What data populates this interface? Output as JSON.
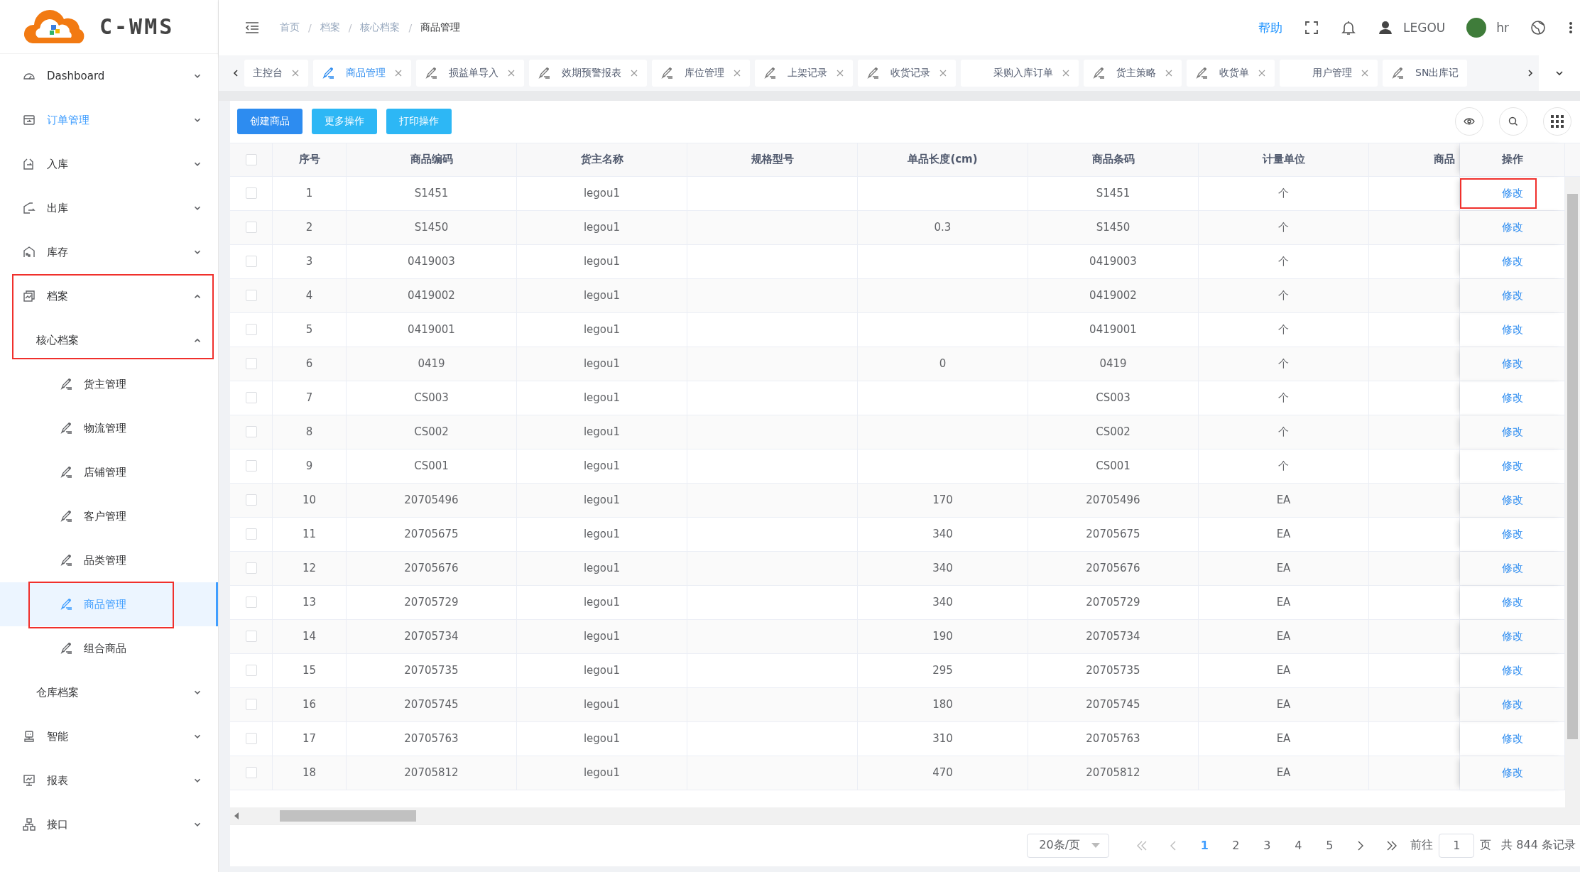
{
  "logo": {
    "text": "C-WMS"
  },
  "sidebar": {
    "menu": [
      {
        "label": "Dashboard",
        "expanded": false,
        "active": false
      },
      {
        "label": "订单管理",
        "expanded": false,
        "active": true
      },
      {
        "label": "入库",
        "expanded": false,
        "active": false
      },
      {
        "label": "出库",
        "expanded": false,
        "active": false
      },
      {
        "label": "库存",
        "expanded": false,
        "active": false
      },
      {
        "label": "档案",
        "expanded": true,
        "active": false,
        "marked": true,
        "children": [
          {
            "label": "核心档案",
            "expanded": true,
            "active": false,
            "marked": true,
            "children": [
              {
                "label": "货主管理",
                "selected": false
              },
              {
                "label": "物流管理",
                "selected": false
              },
              {
                "label": "店铺管理",
                "selected": false
              },
              {
                "label": "客户管理",
                "selected": false
              },
              {
                "label": "品类管理",
                "selected": false
              },
              {
                "label": "商品管理",
                "selected": true,
                "marked": true
              },
              {
                "label": "组合商品",
                "selected": false
              }
            ]
          },
          {
            "label": "仓库档案",
            "expanded": false,
            "active": false
          }
        ]
      },
      {
        "label": "智能",
        "expanded": false,
        "active": false
      },
      {
        "label": "报表",
        "expanded": false,
        "active": false
      },
      {
        "label": "接口",
        "expanded": false,
        "active": false
      }
    ]
  },
  "header": {
    "breadcrumb": [
      "首页",
      "档案",
      "核心档案",
      "商品管理"
    ],
    "separator": "/",
    "help": "帮助",
    "user": "LEGOU",
    "account": "hr"
  },
  "tabs": [
    {
      "label": "主控台",
      "icon": false,
      "selected": false,
      "closable": true
    },
    {
      "label": "商品管理",
      "icon": true,
      "selected": true,
      "closable": true
    },
    {
      "label": "损益单导入",
      "icon": true,
      "selected": false,
      "closable": true
    },
    {
      "label": "效期预警报表",
      "icon": true,
      "selected": false,
      "closable": true
    },
    {
      "label": "库位管理",
      "icon": true,
      "selected": false,
      "closable": true
    },
    {
      "label": "上架记录",
      "icon": true,
      "selected": false,
      "closable": true
    },
    {
      "label": "收货记录",
      "icon": true,
      "selected": false,
      "closable": true
    },
    {
      "label": "采购入库订单",
      "icon": false,
      "selected": false,
      "closable": true
    },
    {
      "label": "货主策略",
      "icon": true,
      "selected": false,
      "closable": true
    },
    {
      "label": "收货单",
      "icon": true,
      "selected": false,
      "closable": true
    },
    {
      "label": "用户管理",
      "icon": false,
      "selected": false,
      "closable": true
    },
    {
      "label": "SN出库记",
      "icon": true,
      "selected": false,
      "closable": false
    }
  ],
  "toolbar": {
    "buttons": [
      {
        "label": "创建商品",
        "kind": "primary"
      },
      {
        "label": "更多操作",
        "kind": "info"
      },
      {
        "label": "打印操作",
        "kind": "info"
      }
    ]
  },
  "table": {
    "select_all": false,
    "columns": [
      "序号",
      "商品编码",
      "货主名称",
      "规格型号",
      "单品长度(cm)",
      "商品条码",
      "计量单位",
      "商品",
      "操作"
    ],
    "rows": [
      {
        "checked": false,
        "no": "1",
        "code": "S1451",
        "owner": "legou1",
        "barcode": "S1451",
        "unit": "个",
        "action": "修改",
        "marked": true
      },
      {
        "checked": false,
        "no": "2",
        "code": "S1450",
        "owner": "legou1",
        "length": "0.3",
        "barcode": "S1450",
        "unit": "个",
        "action": "修改"
      },
      {
        "checked": false,
        "no": "3",
        "code": "0419003",
        "owner": "legou1",
        "barcode": "0419003",
        "unit": "个",
        "action": "修改"
      },
      {
        "checked": false,
        "no": "4",
        "code": "0419002",
        "owner": "legou1",
        "barcode": "0419002",
        "unit": "个",
        "action": "修改"
      },
      {
        "checked": false,
        "no": "5",
        "code": "0419001",
        "owner": "legou1",
        "barcode": "0419001",
        "unit": "个",
        "action": "修改"
      },
      {
        "checked": false,
        "no": "6",
        "code": "0419",
        "owner": "legou1",
        "length": "0",
        "barcode": "0419",
        "unit": "个",
        "action": "修改"
      },
      {
        "checked": false,
        "no": "7",
        "code": "CS003",
        "owner": "legou1",
        "barcode": "CS003",
        "unit": "个",
        "action": "修改"
      },
      {
        "checked": false,
        "no": "8",
        "code": "CS002",
        "owner": "legou1",
        "barcode": "CS002",
        "unit": "个",
        "action": "修改"
      },
      {
        "checked": false,
        "no": "9",
        "code": "CS001",
        "owner": "legou1",
        "barcode": "CS001",
        "unit": "个",
        "action": "修改"
      },
      {
        "checked": false,
        "no": "10",
        "code": "20705496",
        "owner": "legou1",
        "length": "170",
        "barcode": "20705496",
        "unit": "EA",
        "action": "修改"
      },
      {
        "checked": false,
        "no": "11",
        "code": "20705675",
        "owner": "legou1",
        "length": "340",
        "barcode": "20705675",
        "unit": "EA",
        "action": "修改"
      },
      {
        "checked": false,
        "no": "12",
        "code": "20705676",
        "owner": "legou1",
        "length": "340",
        "barcode": "20705676",
        "unit": "EA",
        "action": "修改"
      },
      {
        "checked": false,
        "no": "13",
        "code": "20705729",
        "owner": "legou1",
        "length": "340",
        "barcode": "20705729",
        "unit": "EA",
        "action": "修改"
      },
      {
        "checked": false,
        "no": "14",
        "code": "20705734",
        "owner": "legou1",
        "length": "190",
        "barcode": "20705734",
        "unit": "EA",
        "action": "修改"
      },
      {
        "checked": false,
        "no": "15",
        "code": "20705735",
        "owner": "legou1",
        "length": "295",
        "barcode": "20705735",
        "unit": "EA",
        "action": "修改"
      },
      {
        "checked": false,
        "no": "16",
        "code": "20705745",
        "owner": "legou1",
        "length": "180",
        "barcode": "20705745",
        "unit": "EA",
        "action": "修改"
      },
      {
        "checked": false,
        "no": "17",
        "code": "20705763",
        "owner": "legou1",
        "length": "310",
        "barcode": "20705763",
        "unit": "EA",
        "action": "修改"
      },
      {
        "checked": false,
        "no": "18",
        "code": "20705812",
        "owner": "legou1",
        "length": "470",
        "barcode": "20705812",
        "unit": "EA",
        "action": "修改"
      }
    ]
  },
  "pagination": {
    "page_size": "20条/页",
    "pages": [
      {
        "label": "1",
        "selected": true
      },
      {
        "label": "2",
        "selected": false
      },
      {
        "label": "3",
        "selected": false
      },
      {
        "label": "4",
        "selected": false
      },
      {
        "label": "5",
        "selected": false
      }
    ],
    "goto_label": "前往",
    "goto_value": "1",
    "page_unit": "页",
    "total": "共 844 条记录"
  }
}
